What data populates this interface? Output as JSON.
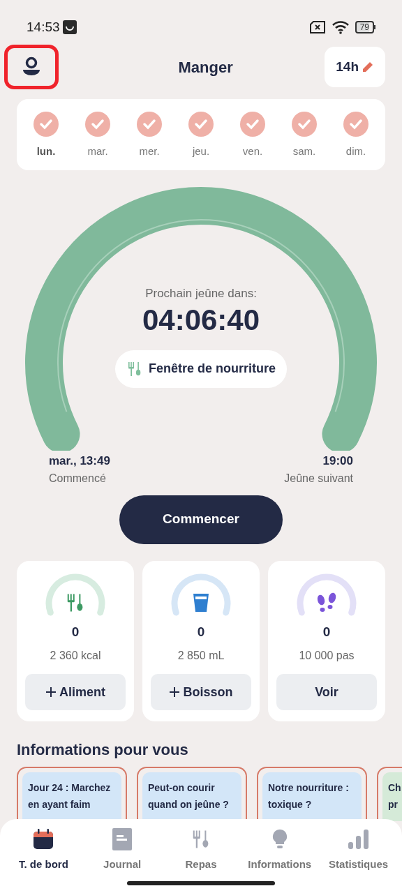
{
  "status_bar": {
    "time": "14:53",
    "battery": "79"
  },
  "header": {
    "title": "Manger",
    "duration": "14h",
    "profile_highlighted": true
  },
  "days": [
    {
      "label": "lun.",
      "checked": true,
      "selected": true
    },
    {
      "label": "mar.",
      "checked": true,
      "selected": false
    },
    {
      "label": "mer.",
      "checked": true,
      "selected": false
    },
    {
      "label": "jeu.",
      "checked": true,
      "selected": false
    },
    {
      "label": "ven.",
      "checked": true,
      "selected": false
    },
    {
      "label": "sam.",
      "checked": true,
      "selected": false
    },
    {
      "label": "dim.",
      "checked": true,
      "selected": false
    }
  ],
  "timer": {
    "caption": "Prochain jeûne dans:",
    "time": "04:06:40",
    "phase": "Fenêtre de nourriture",
    "start_time": "mar., 13:49",
    "start_label": "Commencé",
    "end_time": "19:00",
    "end_label": "Jeûne suivant",
    "button": "Commencer"
  },
  "trackers": [
    {
      "kind": "food",
      "value": "0",
      "goal": "2 360 kcal",
      "button": "Aliment",
      "add": true
    },
    {
      "kind": "drink",
      "value": "0",
      "goal": "2 850 mL",
      "button": "Boisson",
      "add": true
    },
    {
      "kind": "steps",
      "value": "0",
      "goal": "10 000 pas",
      "button": "Voir",
      "add": false
    }
  ],
  "info": {
    "heading": "Informations pour vous",
    "cards": [
      {
        "title": "Jour 24 : Marchez\nen ayant faim",
        "color": "#d3e6f8"
      },
      {
        "title": "Peut-on courir\nquand on jeûne ?",
        "color": "#d3e6f8"
      },
      {
        "title": "Notre nourriture :\ntoxique ?",
        "color": "#d3e6f8"
      },
      {
        "title": "Ch\npr",
        "color": "#d5ead8"
      }
    ]
  },
  "nav": [
    {
      "kind": "calendar",
      "label": "T. de bord",
      "selected": true
    },
    {
      "kind": "journal",
      "label": "Journal",
      "selected": false
    },
    {
      "kind": "meals",
      "label": "Repas",
      "selected": false
    },
    {
      "kind": "info",
      "label": "Informations",
      "selected": false
    },
    {
      "kind": "stats",
      "label": "Statistiques",
      "selected": false
    }
  ]
}
